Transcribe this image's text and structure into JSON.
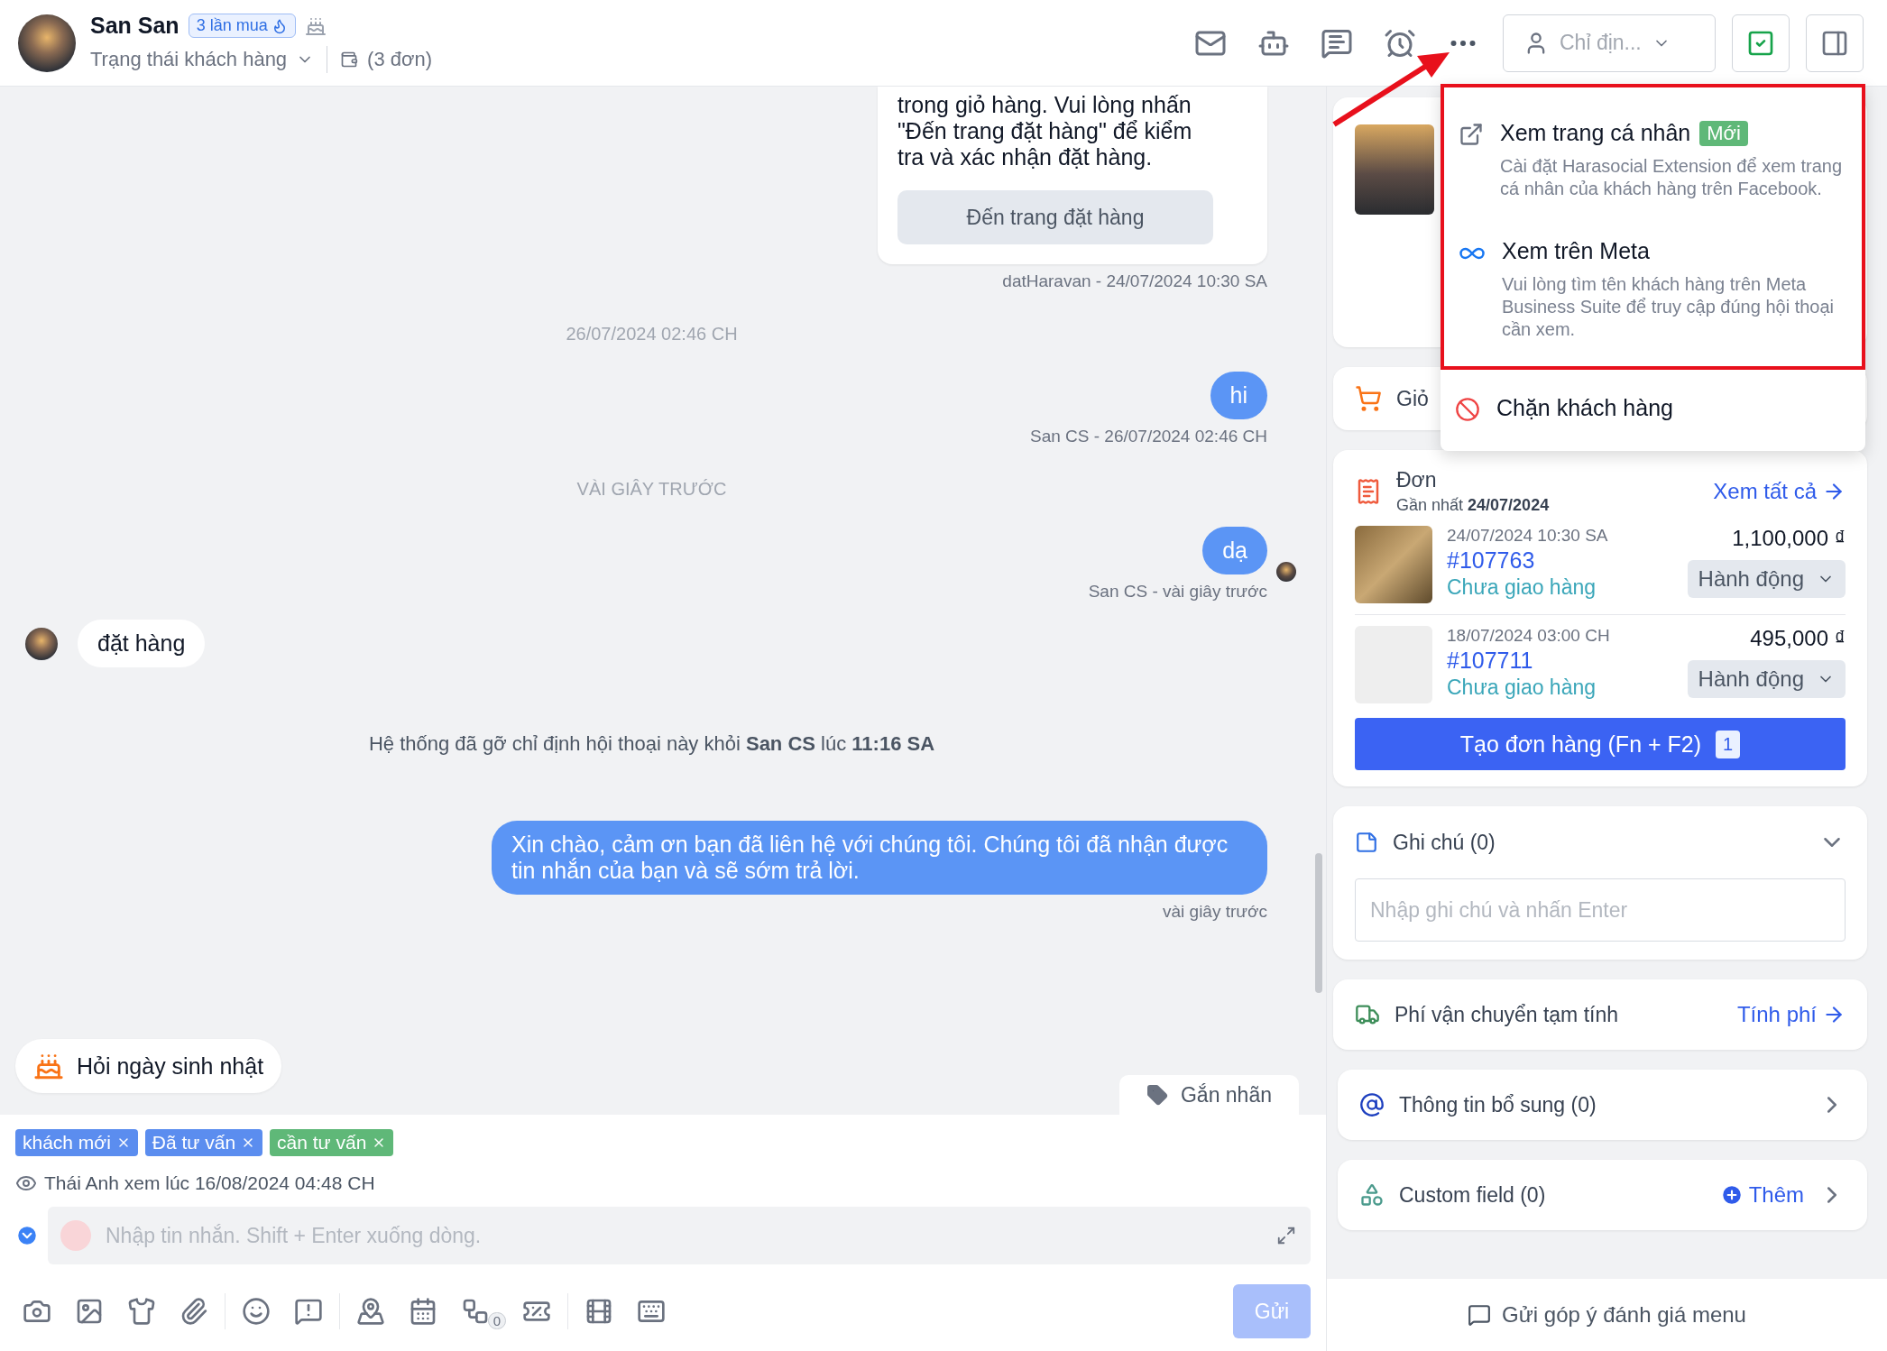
{
  "header": {
    "name": "San San",
    "purchase_badge": "3 lần mua",
    "status_label": "Trạng thái khách hàng",
    "orders_count": "(3 đơn)",
    "assign_placeholder": "Chỉ địn..."
  },
  "chat": {
    "messages": [
      {
        "kind": "card",
        "text": "trong giỏ hàng. Vui lòng nhấn \"Đến trang đặt hàng\" để kiểm tra và xác nhận đặt hàng.",
        "button": "Đến trang đặt hàng",
        "meta": "datHaravan - 24/07/2024 10:30 SA"
      },
      {
        "kind": "separator",
        "text": "26/07/2024 02:46 CH"
      },
      {
        "kind": "outgoing",
        "text": "hi",
        "meta": "San CS - 26/07/2024 02:46 CH",
        "seen": false
      },
      {
        "kind": "separator",
        "text": "VÀI GIÂY TRƯỚC"
      },
      {
        "kind": "outgoing",
        "text": "dạ",
        "meta": "San CS - vài giây trước",
        "seen": true
      },
      {
        "kind": "incoming",
        "text": "đặt hàng"
      },
      {
        "kind": "system",
        "text": "Hệ thống đã gỡ chỉ định hội thoại này khỏi **San CS** lúc **11:16 SA**"
      },
      {
        "kind": "outgoing",
        "text": "Xin chào, cảm ơn bạn đã liên hệ với chúng tôi. Chúng tôi đã nhận được tin nhắn của bạn và sẽ sớm trả lời.",
        "meta": "vài giây trước",
        "seen": false
      }
    ]
  },
  "birthday_chip": "Hỏi ngày sinh nhật",
  "label_tab": "Gắn nhãn",
  "tags": [
    {
      "label": "khách mới",
      "color": "#5b8def"
    },
    {
      "label": "Đã tư vấn",
      "color": "#5b8def"
    },
    {
      "label": "cần tư vấn",
      "color": "#5fb878"
    }
  ],
  "seen_info": "Thái Anh xem lúc 16/08/2024 04:48 CH",
  "composer": {
    "placeholder": "Nhập tin nhắn. Shift + Enter xuống dòng.",
    "flow_count": "0",
    "send": "Gửi",
    "send_disabled": true
  },
  "panel": {
    "cart_title": "Giỏ",
    "orders": {
      "title": "Đơn",
      "latest_label": "Gần nhất **24/07/2024**",
      "view_all": "Xem tất cả",
      "items": [
        {
          "date": "24/07/2024 10:30 SA",
          "id": "#107763",
          "status": "Chưa giao hàng",
          "price": "1,100,000 ₫",
          "action": "Hành động"
        },
        {
          "date": "18/07/2024 03:00 CH",
          "id": "#107711",
          "status": "Chưa giao hàng",
          "price": "495,000 ₫",
          "action": "Hành động"
        }
      ],
      "create": "Tạo đơn hàng (Fn + F2)",
      "create_count": "1"
    },
    "notes": {
      "title": "Ghi chú (0)",
      "expanded": true,
      "placeholder": "Nhập ghi chú và nhấn Enter"
    },
    "shipping": {
      "title": "Phí vận chuyển tạm tính",
      "action": "Tính phí"
    },
    "extra_info": {
      "title": "Thông tin bổ sung (0)"
    },
    "custom_field": {
      "title": "Custom field (0)",
      "action": "Thêm"
    },
    "feedback": "Gửi góp ý đánh giá menu"
  },
  "menu": {
    "items": [
      {
        "kind": "profile",
        "title": "Xem trang cá nhân",
        "badge": "Mới",
        "description": "Cài đặt Harasocial Extension để xem trang cá nhân của khách hàng trên Facebook.",
        "highlighted": true
      },
      {
        "kind": "meta",
        "title": "Xem trên Meta",
        "description": "Vui lòng tìm tên khách hàng trên Meta Business Suite để truy cập đúng hội thoại cần xem.",
        "highlighted": true
      },
      {
        "kind": "block",
        "title": "Chặn khách hàng",
        "highlighted": false
      }
    ]
  }
}
